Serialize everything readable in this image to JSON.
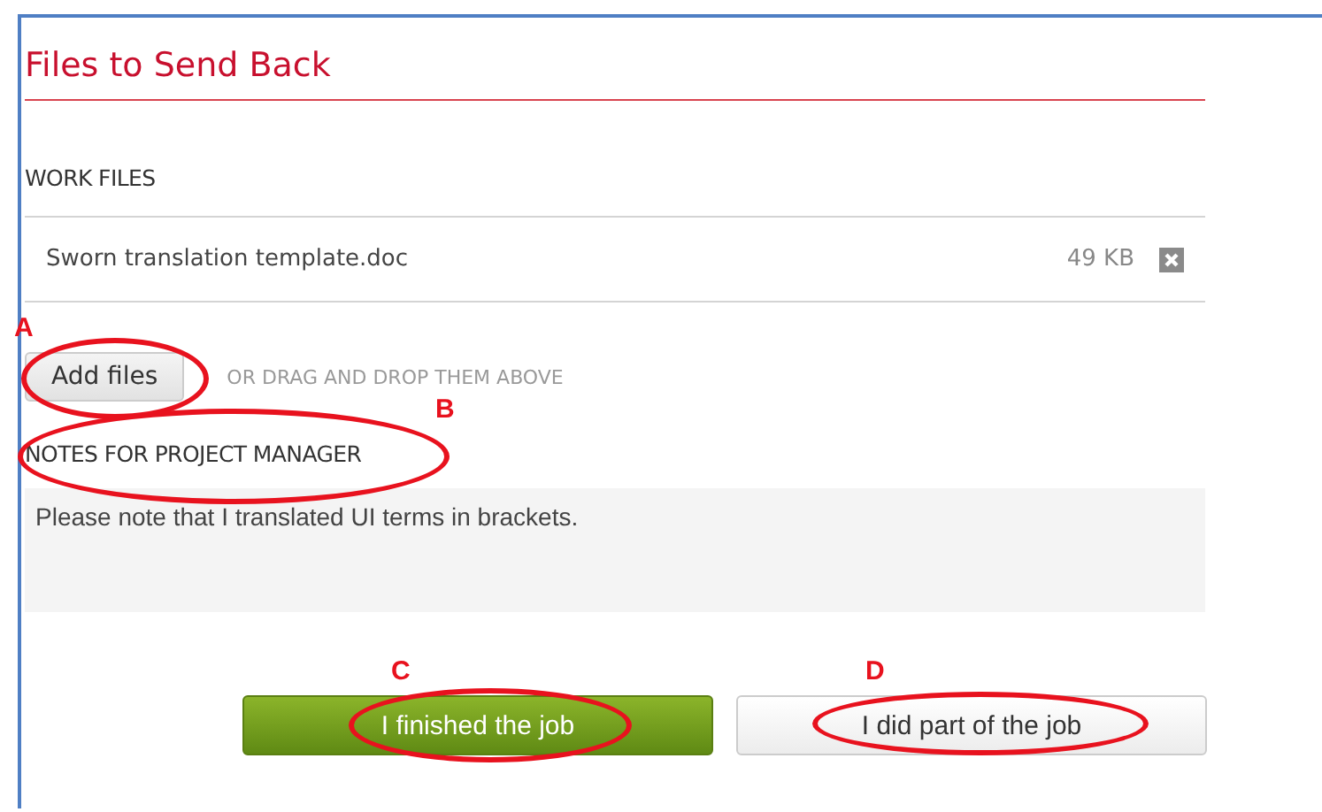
{
  "title": "Files to Send Back",
  "work_files": {
    "heading": "WORK FILES",
    "files": [
      {
        "name": "Sworn translation template.doc",
        "size": "49 KB"
      }
    ],
    "add_button": {
      "label": "Add files",
      "callout": "A"
    },
    "drop_hint": "OR DRAG AND DROP THEM ABOVE"
  },
  "notes": {
    "heading": "NOTES FOR PROJECT MANAGER",
    "callout": "B",
    "value": "Please note that I translated UI terms in brackets."
  },
  "buttons": [
    {
      "label": "I finished the job",
      "kind": "primary",
      "callout": "C"
    },
    {
      "label": "I did part of the job",
      "kind": "secondary",
      "callout": "D"
    }
  ]
}
